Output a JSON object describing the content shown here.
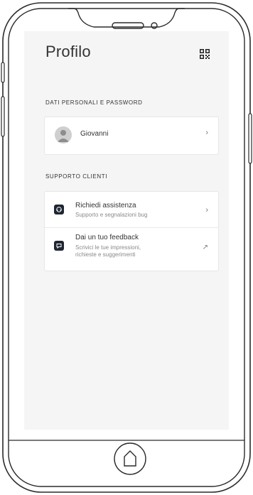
{
  "header": {
    "title": "Profilo",
    "qr_icon": "qr-code-icon"
  },
  "sections": {
    "personal": {
      "title": "Dati personali e password",
      "user": {
        "name": "Giovanni",
        "avatar_icon": "user-avatar-icon",
        "chevron": "›"
      }
    },
    "support": {
      "title": "Supporto clienti",
      "items": [
        {
          "title": "Richiedi assistenza",
          "subtitle": "Supporto e segnalazioni bug",
          "icon": "assistance-icon",
          "trailing": "›"
        },
        {
          "title": "Dai un tuo feedback",
          "subtitle_line1": "Scrivici le tue impressioni,",
          "subtitle_line2": "richieste e suggerimenti",
          "icon": "feedback-icon",
          "trailing": "↗"
        }
      ]
    }
  },
  "colors": {
    "screen_bg": "#f5f5f5",
    "card_bg": "#ffffff",
    "text_primary": "#333333",
    "text_secondary": "#8a8a8a",
    "icon_bg": "#1f2633"
  }
}
